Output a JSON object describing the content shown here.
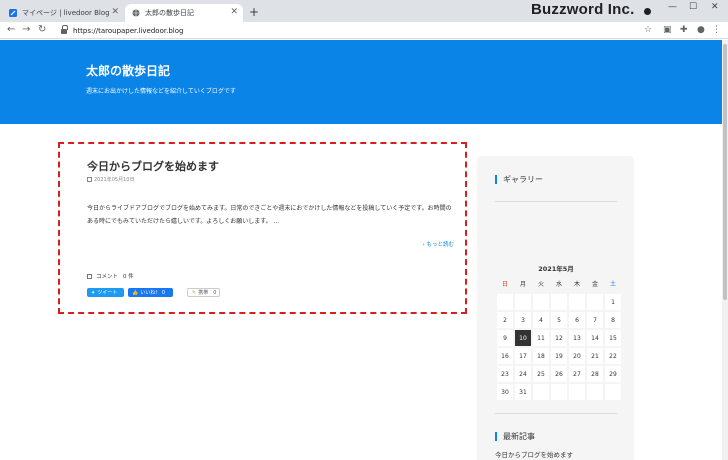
{
  "browser": {
    "tabs": [
      {
        "title": "マイページ | livedoor Blog"
      },
      {
        "title": "太郎の散歩日記"
      }
    ],
    "new_tab": "+",
    "url": "https://taroupaper.livedoor.blog",
    "brand": "Buzzword Inc.",
    "window_controls": {
      "minimize": "—",
      "maximize": "☐",
      "close": "✕"
    },
    "nav": {
      "back": "←",
      "forward": "→",
      "reload": "↻"
    }
  },
  "blog": {
    "title": "太郎の散歩日記",
    "description": "週末にお出かけした情報などを紹介していくブログです"
  },
  "post": {
    "title": "今日からブログを始めます",
    "date": "2021年05月10日",
    "body": "今日からライブドアブログでブログを始めてみます。日常のできごとや週末におでかけした情報などを投稿していく予定です。お時間のある時にでもみていただけたら嬉しいです。よろしくお願いします。 ...",
    "read_more": "› もっと読む",
    "comment_label": "コメント",
    "comment_count": "0 件",
    "share": {
      "tweet": "ツイート",
      "like": "いいね！ 0",
      "livedoor": "携帯",
      "livedoor_count": "0"
    }
  },
  "sidebar": {
    "gallery_heading": "ギャラリー",
    "calendar": {
      "month_title": "2021年5月",
      "weekdays": [
        "日",
        "月",
        "火",
        "水",
        "木",
        "金",
        "土"
      ],
      "weeks": [
        [
          "",
          "",
          "",
          "",
          "",
          "",
          "1"
        ],
        [
          "2",
          "3",
          "4",
          "5",
          "6",
          "7",
          "8"
        ],
        [
          "9",
          "10",
          "11",
          "12",
          "13",
          "14",
          "15"
        ],
        [
          "16",
          "17",
          "18",
          "19",
          "20",
          "21",
          "22"
        ],
        [
          "23",
          "24",
          "25",
          "26",
          "27",
          "28",
          "29"
        ],
        [
          "30",
          "31",
          "",
          "",
          "",
          "",
          ""
        ]
      ],
      "today": "10"
    },
    "recent_heading": "最新記事",
    "recent_posts": [
      "今日からブログを始めます"
    ]
  },
  "colors": {
    "hero": "#0a84e6",
    "dashed_highlight": "#d91e1e",
    "sunday": "#e03a3a",
    "saturday": "#1a6fd6"
  }
}
